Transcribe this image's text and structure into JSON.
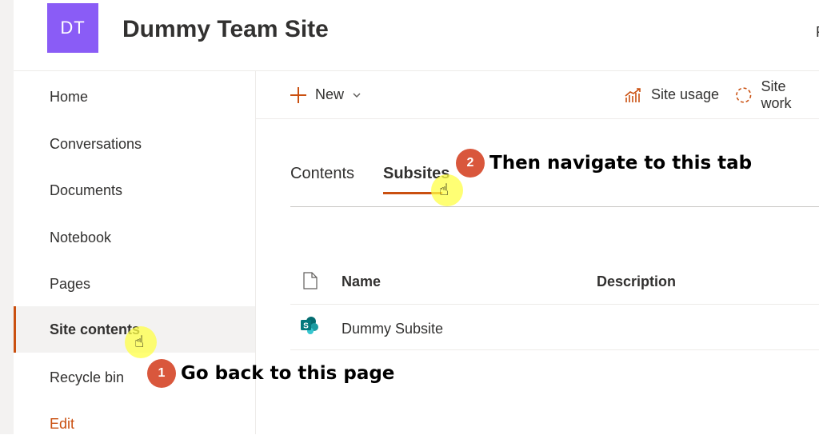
{
  "header": {
    "logo_initials": "DT",
    "site_title": "Dummy Team Site",
    "cut_text": "F"
  },
  "nav": {
    "items": [
      {
        "label": "Home"
      },
      {
        "label": "Conversations"
      },
      {
        "label": "Documents"
      },
      {
        "label": "Notebook"
      },
      {
        "label": "Pages"
      },
      {
        "label": "Site contents",
        "active": true
      },
      {
        "label": "Recycle bin"
      },
      {
        "label": "Edit"
      }
    ]
  },
  "commandbar": {
    "new_label": "New",
    "site_usage_label": "Site usage",
    "site_workflows_label": "Site work"
  },
  "tabs": [
    {
      "label": "Contents"
    },
    {
      "label": "Subsites",
      "selected": true
    }
  ],
  "table": {
    "columns": [
      "Name",
      "Description"
    ],
    "rows": [
      {
        "name": "Dummy Subsite",
        "description": ""
      }
    ]
  },
  "callouts": [
    {
      "number": "1",
      "text": "Go back to this page"
    },
    {
      "number": "2",
      "text": "Then navigate to this tab"
    }
  ],
  "colors": {
    "accent": "#ca5010",
    "logo": "#8a5cf6",
    "badge": "#d9573c",
    "sharepoint": "#038387"
  }
}
